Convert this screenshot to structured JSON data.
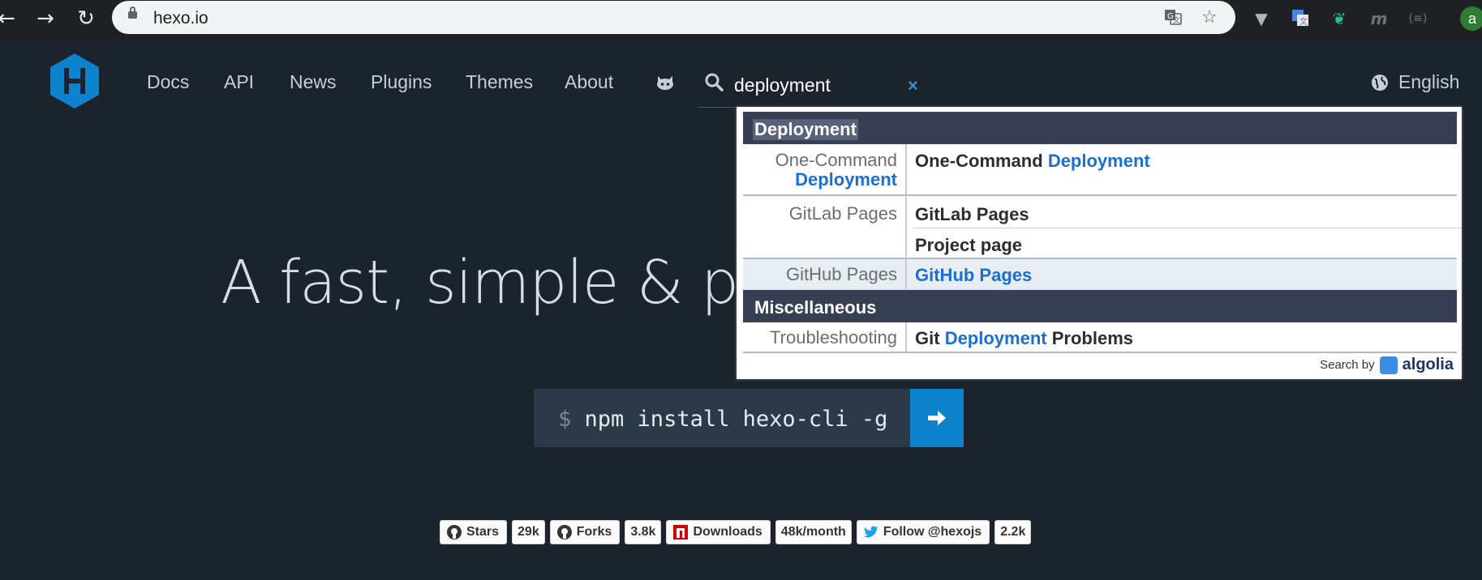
{
  "browser": {
    "url": "hexo.io",
    "nav": {
      "back": "←",
      "forward": "→",
      "reload": "↻"
    },
    "profile_initial": "a",
    "icons": [
      "translate-icon",
      "bookmark-star-icon",
      "vivaldi-extension-icon",
      "google-translate-extension-icon",
      "dino-extension-icon",
      "m-extension-icon",
      "equals-extension-icon"
    ]
  },
  "site": {
    "logo_letter": "H",
    "nav": [
      "Docs",
      "API",
      "News",
      "Plugins",
      "Themes",
      "About"
    ],
    "search_value": "deployment",
    "clear_label": "×",
    "language": "English",
    "hero_text": "A fast, simple & pow",
    "install": {
      "prompt": "$",
      "command": "npm install hexo-cli -g"
    },
    "badges": [
      {
        "label": "Stars",
        "count": "29k"
      },
      {
        "label": "Forks",
        "count": "3.8k"
      },
      {
        "label": "Downloads",
        "count": "48k/month"
      },
      {
        "label": "Follow @hexojs",
        "count": "2.2k"
      }
    ]
  },
  "search_dropdown": {
    "categories": [
      "Deployment",
      "Miscellaneous"
    ],
    "results": [
      {
        "left_plain": "One-Command",
        "left_em": "Deployment",
        "right_plain": "One-Command",
        "right_em": "Deployment"
      },
      {
        "left": "GitLab Pages",
        "right": "GitLab Pages",
        "right_sub": "Project page"
      },
      {
        "left": "GitHub Pages",
        "right_em": "GitHub Pages"
      },
      {
        "left": "Troubleshooting",
        "right_pre": "Git",
        "right_em": "Deployment",
        "right_post": "Problems"
      }
    ],
    "footer": {
      "label": "Search by",
      "brand": "algolia"
    }
  }
}
